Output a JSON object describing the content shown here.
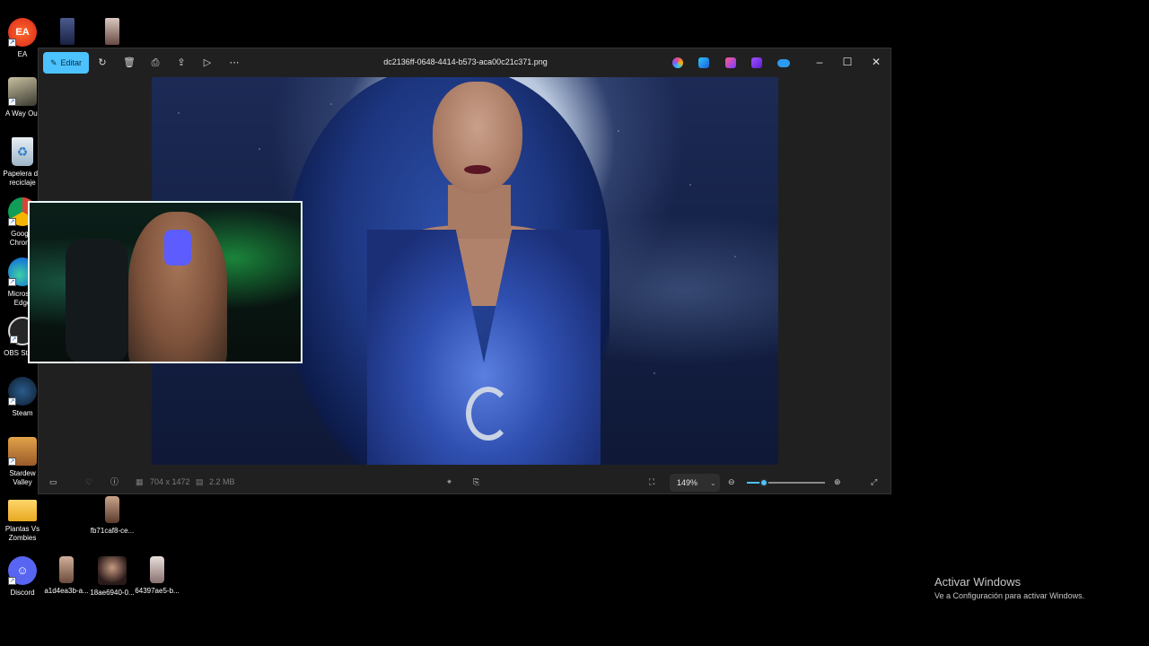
{
  "desktop": {
    "icons": [
      {
        "name": "ea",
        "label": "EA"
      },
      {
        "name": "a-way-out",
        "label": "A Way Out"
      },
      {
        "name": "recycle-bin",
        "label": "Papelera de reciclaje"
      },
      {
        "name": "google-chrome",
        "label": "Google Chrome"
      },
      {
        "name": "microsoft-edge",
        "label": "Microsoft Edge"
      },
      {
        "name": "obs-studio",
        "label": "OBS Studio"
      },
      {
        "name": "steam",
        "label": "Steam"
      },
      {
        "name": "stardew-valley",
        "label": "Stardew Valley"
      },
      {
        "name": "plantas-vs-zombies",
        "label": "Plantas Vs Zombies"
      },
      {
        "name": "discord",
        "label": "Discord"
      }
    ],
    "files": [
      {
        "label": "fb71caf8-ce..."
      },
      {
        "label": "a1d4ea3b-a..."
      },
      {
        "label": "18ae6940-0..."
      },
      {
        "label": "64397ae5-b..."
      }
    ]
  },
  "photos_window": {
    "title": "dc2136ff-0648-4414-b573-aca00c21c371.png",
    "edit_label": "Editar",
    "image_dimensions": "704 x 1472",
    "file_size": "2.2 MB",
    "zoom_level": "149%",
    "zoom_fraction": 0.22
  },
  "watermark": {
    "title": "Activar Windows",
    "subtitle": "Ve a Configuración para activar Windows."
  },
  "colors": {
    "accent": "#4cc2ff",
    "window_bg": "#202020"
  }
}
